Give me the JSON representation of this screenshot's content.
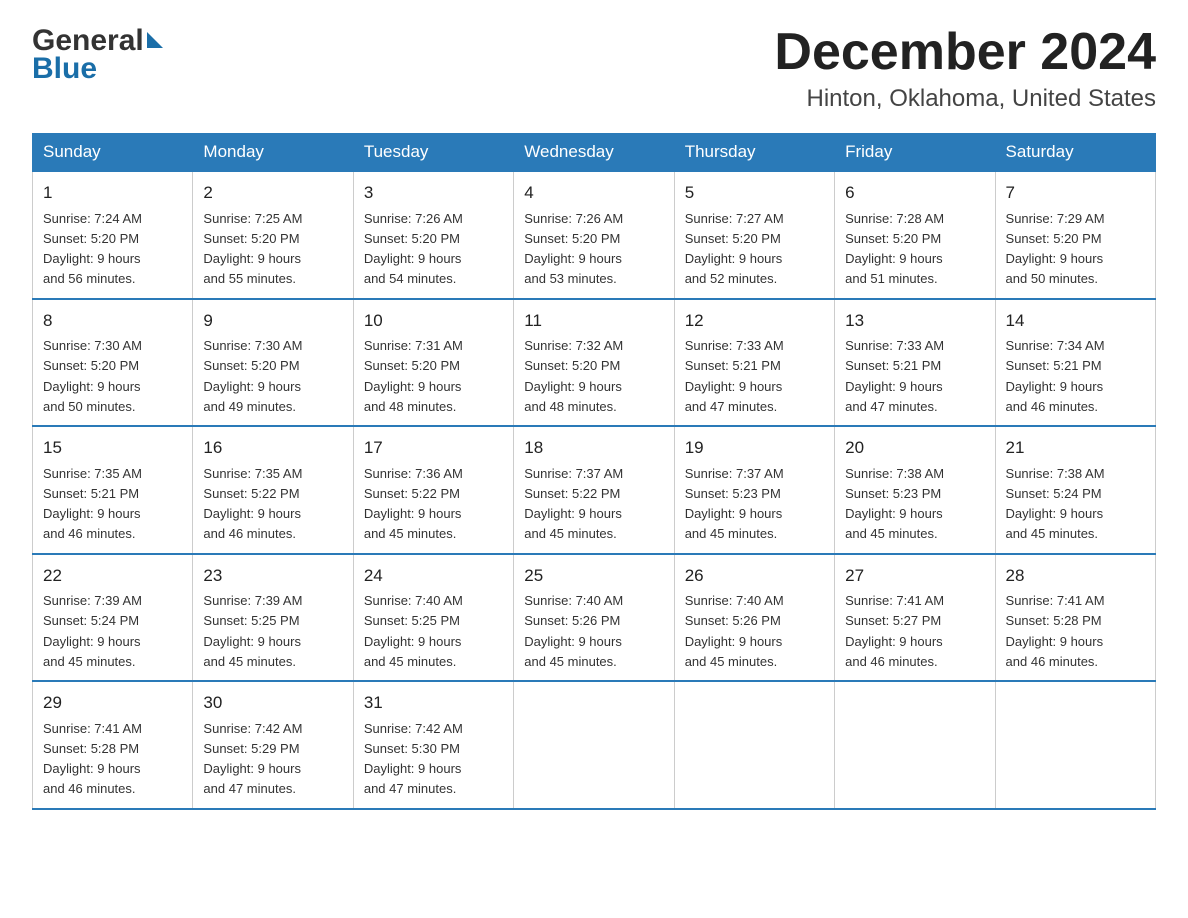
{
  "header": {
    "logo_general": "General",
    "logo_blue": "Blue",
    "month_title": "December 2024",
    "location": "Hinton, Oklahoma, United States"
  },
  "days_of_week": [
    "Sunday",
    "Monday",
    "Tuesday",
    "Wednesday",
    "Thursday",
    "Friday",
    "Saturday"
  ],
  "weeks": [
    [
      {
        "day": "1",
        "sunrise": "7:24 AM",
        "sunset": "5:20 PM",
        "daylight": "9 hours and 56 minutes."
      },
      {
        "day": "2",
        "sunrise": "7:25 AM",
        "sunset": "5:20 PM",
        "daylight": "9 hours and 55 minutes."
      },
      {
        "day": "3",
        "sunrise": "7:26 AM",
        "sunset": "5:20 PM",
        "daylight": "9 hours and 54 minutes."
      },
      {
        "day": "4",
        "sunrise": "7:26 AM",
        "sunset": "5:20 PM",
        "daylight": "9 hours and 53 minutes."
      },
      {
        "day": "5",
        "sunrise": "7:27 AM",
        "sunset": "5:20 PM",
        "daylight": "9 hours and 52 minutes."
      },
      {
        "day": "6",
        "sunrise": "7:28 AM",
        "sunset": "5:20 PM",
        "daylight": "9 hours and 51 minutes."
      },
      {
        "day": "7",
        "sunrise": "7:29 AM",
        "sunset": "5:20 PM",
        "daylight": "9 hours and 50 minutes."
      }
    ],
    [
      {
        "day": "8",
        "sunrise": "7:30 AM",
        "sunset": "5:20 PM",
        "daylight": "9 hours and 50 minutes."
      },
      {
        "day": "9",
        "sunrise": "7:30 AM",
        "sunset": "5:20 PM",
        "daylight": "9 hours and 49 minutes."
      },
      {
        "day": "10",
        "sunrise": "7:31 AM",
        "sunset": "5:20 PM",
        "daylight": "9 hours and 48 minutes."
      },
      {
        "day": "11",
        "sunrise": "7:32 AM",
        "sunset": "5:20 PM",
        "daylight": "9 hours and 48 minutes."
      },
      {
        "day": "12",
        "sunrise": "7:33 AM",
        "sunset": "5:21 PM",
        "daylight": "9 hours and 47 minutes."
      },
      {
        "day": "13",
        "sunrise": "7:33 AM",
        "sunset": "5:21 PM",
        "daylight": "9 hours and 47 minutes."
      },
      {
        "day": "14",
        "sunrise": "7:34 AM",
        "sunset": "5:21 PM",
        "daylight": "9 hours and 46 minutes."
      }
    ],
    [
      {
        "day": "15",
        "sunrise": "7:35 AM",
        "sunset": "5:21 PM",
        "daylight": "9 hours and 46 minutes."
      },
      {
        "day": "16",
        "sunrise": "7:35 AM",
        "sunset": "5:22 PM",
        "daylight": "9 hours and 46 minutes."
      },
      {
        "day": "17",
        "sunrise": "7:36 AM",
        "sunset": "5:22 PM",
        "daylight": "9 hours and 45 minutes."
      },
      {
        "day": "18",
        "sunrise": "7:37 AM",
        "sunset": "5:22 PM",
        "daylight": "9 hours and 45 minutes."
      },
      {
        "day": "19",
        "sunrise": "7:37 AM",
        "sunset": "5:23 PM",
        "daylight": "9 hours and 45 minutes."
      },
      {
        "day": "20",
        "sunrise": "7:38 AM",
        "sunset": "5:23 PM",
        "daylight": "9 hours and 45 minutes."
      },
      {
        "day": "21",
        "sunrise": "7:38 AM",
        "sunset": "5:24 PM",
        "daylight": "9 hours and 45 minutes."
      }
    ],
    [
      {
        "day": "22",
        "sunrise": "7:39 AM",
        "sunset": "5:24 PM",
        "daylight": "9 hours and 45 minutes."
      },
      {
        "day": "23",
        "sunrise": "7:39 AM",
        "sunset": "5:25 PM",
        "daylight": "9 hours and 45 minutes."
      },
      {
        "day": "24",
        "sunrise": "7:40 AM",
        "sunset": "5:25 PM",
        "daylight": "9 hours and 45 minutes."
      },
      {
        "day": "25",
        "sunrise": "7:40 AM",
        "sunset": "5:26 PM",
        "daylight": "9 hours and 45 minutes."
      },
      {
        "day": "26",
        "sunrise": "7:40 AM",
        "sunset": "5:26 PM",
        "daylight": "9 hours and 45 minutes."
      },
      {
        "day": "27",
        "sunrise": "7:41 AM",
        "sunset": "5:27 PM",
        "daylight": "9 hours and 46 minutes."
      },
      {
        "day": "28",
        "sunrise": "7:41 AM",
        "sunset": "5:28 PM",
        "daylight": "9 hours and 46 minutes."
      }
    ],
    [
      {
        "day": "29",
        "sunrise": "7:41 AM",
        "sunset": "5:28 PM",
        "daylight": "9 hours and 46 minutes."
      },
      {
        "day": "30",
        "sunrise": "7:42 AM",
        "sunset": "5:29 PM",
        "daylight": "9 hours and 47 minutes."
      },
      {
        "day": "31",
        "sunrise": "7:42 AM",
        "sunset": "5:30 PM",
        "daylight": "9 hours and 47 minutes."
      },
      null,
      null,
      null,
      null
    ]
  ],
  "labels": {
    "sunrise": "Sunrise:",
    "sunset": "Sunset:",
    "daylight": "Daylight:"
  }
}
